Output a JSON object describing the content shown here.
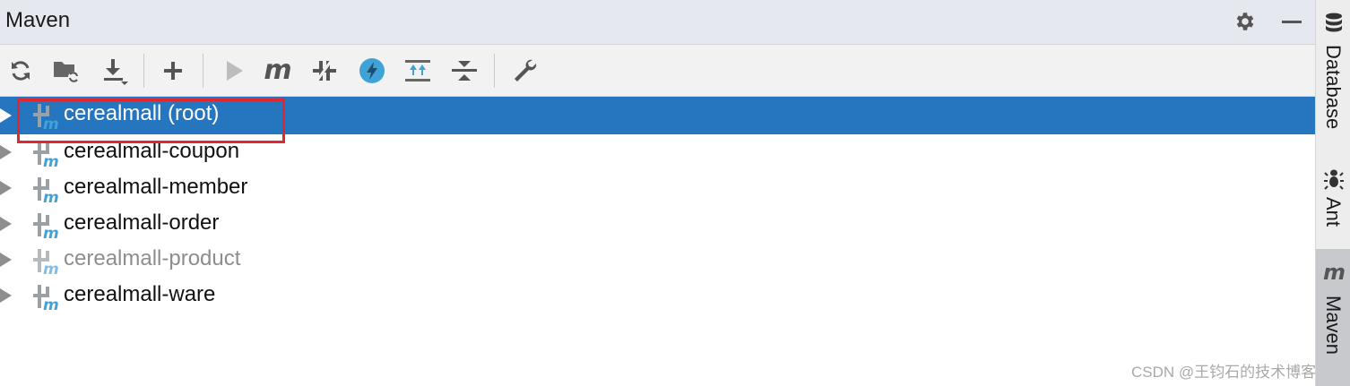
{
  "panel": {
    "title": "Maven"
  },
  "header_icons": [
    {
      "name": "gear-icon"
    },
    {
      "name": "minimize-icon"
    }
  ],
  "toolbar": {
    "buttons": [
      {
        "name": "reload-all-projects-button",
        "icon": "refresh-icon"
      },
      {
        "name": "generate-sources-button",
        "icon": "folder-refresh-icon"
      },
      {
        "name": "download-sources-button",
        "icon": "download-icon"
      },
      {
        "name": "add-maven-project-button",
        "icon": "plus-icon"
      },
      {
        "name": "run-maven-build-button",
        "icon": "play-icon"
      },
      {
        "name": "execute-maven-goal-button",
        "icon": "maven-m-icon"
      },
      {
        "name": "toggle-offline-mode-button",
        "icon": "offline-icon"
      },
      {
        "name": "skip-tests-button",
        "icon": "lightning-icon"
      },
      {
        "name": "show-dependencies-button",
        "icon": "expand-all-icon"
      },
      {
        "name": "collapse-all-button",
        "icon": "collapse-all-icon"
      },
      {
        "name": "maven-settings-button",
        "icon": "wrench-icon"
      }
    ]
  },
  "tree": {
    "items": [
      {
        "label": "cerealmall (root)",
        "selected": true,
        "dim": false
      },
      {
        "label": "cerealmall-coupon",
        "selected": false,
        "dim": false
      },
      {
        "label": "cerealmall-member",
        "selected": false,
        "dim": false
      },
      {
        "label": "cerealmall-order",
        "selected": false,
        "dim": false
      },
      {
        "label": "cerealmall-product",
        "selected": false,
        "dim": true
      },
      {
        "label": "cerealmall-ware",
        "selected": false,
        "dim": false
      }
    ]
  },
  "sidebar": {
    "tabs": [
      {
        "label": "Database",
        "icon": "database-icon",
        "active": false
      },
      {
        "label": "Ant",
        "icon": "ant-icon",
        "active": false
      },
      {
        "label": "Maven",
        "icon": "maven-m-icon",
        "active": true
      }
    ]
  },
  "watermark": "CSDN @王钧石的技术博客",
  "colors": {
    "selection": "#2675bf",
    "highlight_box": "#e0262e",
    "accent_blue": "#3fa3d8"
  }
}
